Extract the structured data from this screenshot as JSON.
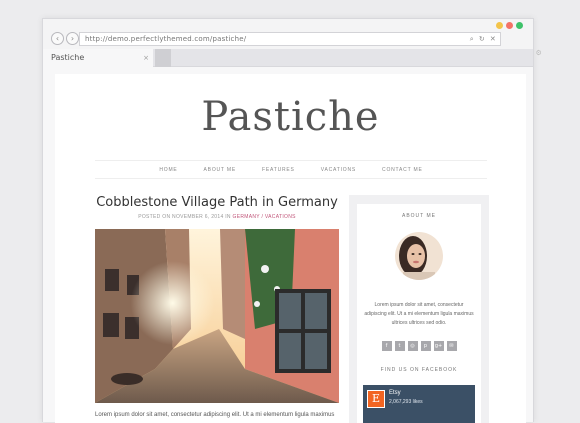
{
  "browser": {
    "url": "http://demo.perfectlythemed.com/pastiche/",
    "tab_title": "Pastiche",
    "tab_close": "×",
    "back": "‹",
    "forward": "›",
    "colors": {
      "close": "#f3c44a",
      "min": "#f37266",
      "max": "#3ec26a"
    }
  },
  "site": {
    "logo": "Pastiche",
    "nav": [
      "HOME",
      "ABOUT ME",
      "FEATURES",
      "VACATIONS",
      "CONTACT ME"
    ]
  },
  "post": {
    "title": "Cobblestone Village Path in Germany",
    "meta_prefix": "POSTED ON NOVEMBER 6, 2014 IN",
    "categories": "GERMANY / VACATIONS",
    "excerpt": "Lorem ipsum dolor sit amet, consectetur adipiscing elit. Ut a mi elementum ligula maximus"
  },
  "sidebar": {
    "about_title": "ABOUT ME",
    "bio": "Lorem ipsum dolor sit amet, consectetur adipiscing elit. Ut a mi elementum ligula maximus ultrices ultrices sed odio.",
    "socials": [
      "f",
      "t",
      "◎",
      "p",
      "g+",
      "✉"
    ],
    "facebook_title": "FIND US ON FACEBOOK",
    "fb_logo": "E",
    "fb_name": "Etsy",
    "fb_likes": "2,067,293 likes"
  }
}
